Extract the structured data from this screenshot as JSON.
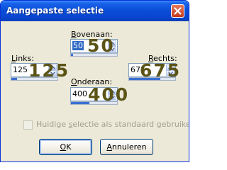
{
  "window": {
    "title": "Aangepaste selectie"
  },
  "fields": {
    "bovenaan": {
      "label_pre": "",
      "label_accel": "B",
      "label_post": "ovenaan:",
      "value": "50",
      "overlay": "50",
      "fill": 0.05
    },
    "links": {
      "label_pre": "",
      "label_accel": "L",
      "label_post": "inks:",
      "value": "125",
      "overlay": "125",
      "fill": 0.12
    },
    "rechts": {
      "label_pre": "",
      "label_accel": "R",
      "label_post": "echts:",
      "value": "675",
      "overlay": "675",
      "fill": 0.67
    },
    "onderaan": {
      "label_pre": "",
      "label_accel": "O",
      "label_post": "nderaan:",
      "value": "400",
      "overlay": "400",
      "fill": 0.4
    }
  },
  "checkbox": {
    "label_pre": "Huidige ",
    "label_accel": "s",
    "label_post": "electie als standaard gebruiken",
    "checked": false,
    "enabled": false
  },
  "buttons": {
    "ok": {
      "label_accel": "O",
      "label_post": "K"
    },
    "cancel": {
      "label_accel": "A",
      "label_post": "nnuleren"
    }
  }
}
